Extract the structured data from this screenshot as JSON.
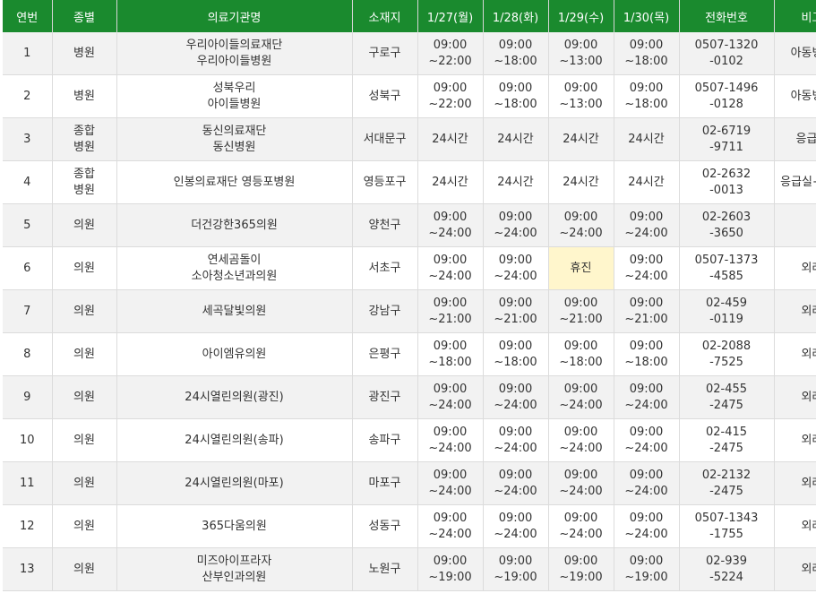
{
  "headers": [
    "연번",
    "종별",
    "의료기관명",
    "소재지",
    "1/27(월)",
    "1/28(화)",
    "1/29(수)",
    "1/30(목)",
    "전화번호",
    "비고"
  ],
  "closed_color": "#fff6cc",
  "header_color": "#1a8a2e",
  "rows": [
    {
      "no": "1",
      "type": [
        "병원"
      ],
      "name": [
        "우리아이들의료재단",
        "우리아이들병원"
      ],
      "loc": "구로구",
      "d1": [
        "09:00",
        "~22:00"
      ],
      "d2": [
        "09:00",
        "~18:00"
      ],
      "d3": [
        "09:00",
        "~13:00"
      ],
      "d4": [
        "09:00",
        "~18:00"
      ],
      "tel": [
        "0507-1320",
        "-0102"
      ],
      "note": "아동병원"
    },
    {
      "no": "2",
      "type": [
        "병원"
      ],
      "name": [
        "성북우리",
        "아이들병원"
      ],
      "loc": "성북구",
      "d1": [
        "09:00",
        "~22:00"
      ],
      "d2": [
        "09:00",
        "~18:00"
      ],
      "d3": [
        "09:00",
        "~13:00"
      ],
      "d4": [
        "09:00",
        "~18:00"
      ],
      "tel": [
        "0507-1496",
        "-0128"
      ],
      "note": "아동병원"
    },
    {
      "no": "3",
      "type": [
        "종합",
        "병원"
      ],
      "name": [
        "동신의료재단",
        "동신병원"
      ],
      "loc": "서대문구",
      "d1": [
        "24시간"
      ],
      "d2": [
        "24시간"
      ],
      "d3": [
        "24시간"
      ],
      "d4": [
        "24시간"
      ],
      "tel": [
        "02-6719",
        "-9711"
      ],
      "note": "응급실"
    },
    {
      "no": "4",
      "type": [
        "종합",
        "병원"
      ],
      "name": [
        "인봉의료재단 영등포병원"
      ],
      "loc": "영등포구",
      "d1": [
        "24시간"
      ],
      "d2": [
        "24시간"
      ],
      "d3": [
        "24시간"
      ],
      "d4": [
        "24시간"
      ],
      "tel": [
        "02-2632",
        "-0013"
      ],
      "note": "응급실+외래"
    },
    {
      "no": "5",
      "type": [
        "의원"
      ],
      "name": [
        "더건강한365의원"
      ],
      "loc": "양천구",
      "d1": [
        "09:00",
        "~24:00"
      ],
      "d2": [
        "09:00",
        "~24:00"
      ],
      "d3": [
        "09:00",
        "~24:00"
      ],
      "d4": [
        "09:00",
        "~24:00"
      ],
      "tel": [
        "02-2603",
        "-3650"
      ],
      "note": ""
    },
    {
      "no": "6",
      "type": [
        "의원"
      ],
      "name": [
        "연세곰돌이",
        "소아청소년과의원"
      ],
      "loc": "서초구",
      "d1": [
        "09:00",
        "~24:00"
      ],
      "d2": [
        "09:00",
        "~24:00"
      ],
      "d3": [
        "휴진"
      ],
      "d4": [
        "09:00",
        "~24:00"
      ],
      "tel": [
        "0507-1373",
        "-4585"
      ],
      "note": "외래",
      "closed_day": "d3"
    },
    {
      "no": "7",
      "type": [
        "의원"
      ],
      "name": [
        "세곡달빛의원"
      ],
      "loc": "강남구",
      "d1": [
        "09:00",
        "~21:00"
      ],
      "d2": [
        "09:00",
        "~21:00"
      ],
      "d3": [
        "09:00",
        "~21:00"
      ],
      "d4": [
        "09:00",
        "~21:00"
      ],
      "tel": [
        "02-459",
        "-0119"
      ],
      "note": "외래"
    },
    {
      "no": "8",
      "type": [
        "의원"
      ],
      "name": [
        "아이엠유의원"
      ],
      "loc": "은평구",
      "d1": [
        "09:00",
        "~18:00"
      ],
      "d2": [
        "09:00",
        "~18:00"
      ],
      "d3": [
        "09:00",
        "~18:00"
      ],
      "d4": [
        "09:00",
        "~18:00"
      ],
      "tel": [
        "02-2088",
        "-7525"
      ],
      "note": "외래"
    },
    {
      "no": "9",
      "type": [
        "의원"
      ],
      "name": [
        "24시열린의원(광진)"
      ],
      "loc": "광진구",
      "d1": [
        "09:00",
        "~24:00"
      ],
      "d2": [
        "09:00",
        "~24:00"
      ],
      "d3": [
        "09:00",
        "~24:00"
      ],
      "d4": [
        "09:00",
        "~24:00"
      ],
      "tel": [
        "02-455",
        "-2475"
      ],
      "note": "외래"
    },
    {
      "no": "10",
      "type": [
        "의원"
      ],
      "name": [
        "24시열린의원(송파)"
      ],
      "loc": "송파구",
      "d1": [
        "09:00",
        "~24:00"
      ],
      "d2": [
        "09:00",
        "~24:00"
      ],
      "d3": [
        "09:00",
        "~24:00"
      ],
      "d4": [
        "09:00",
        "~24:00"
      ],
      "tel": [
        "02-415",
        "-2475"
      ],
      "note": "외래"
    },
    {
      "no": "11",
      "type": [
        "의원"
      ],
      "name": [
        "24시열린의원(마포)"
      ],
      "loc": "마포구",
      "d1": [
        "09:00",
        "~24:00"
      ],
      "d2": [
        "09:00",
        "~24:00"
      ],
      "d3": [
        "09:00",
        "~24:00"
      ],
      "d4": [
        "09:00",
        "~24:00"
      ],
      "tel": [
        "02-2132",
        "-2475"
      ],
      "note": "외래"
    },
    {
      "no": "12",
      "type": [
        "의원"
      ],
      "name": [
        "365다움의원"
      ],
      "loc": "성동구",
      "d1": [
        "09:00",
        "~24:00"
      ],
      "d2": [
        "09:00",
        "~24:00"
      ],
      "d3": [
        "09:00",
        "~24:00"
      ],
      "d4": [
        "09:00",
        "~24:00"
      ],
      "tel": [
        "0507-1343",
        "-1755"
      ],
      "note": "외래"
    },
    {
      "no": "13",
      "type": [
        "의원"
      ],
      "name": [
        "미즈아이프라자",
        "산부인과의원"
      ],
      "loc": "노원구",
      "d1": [
        "09:00",
        "~19:00"
      ],
      "d2": [
        "09:00",
        "~19:00"
      ],
      "d3": [
        "09:00",
        "~19:00"
      ],
      "d4": [
        "09:00",
        "~19:00"
      ],
      "tel": [
        "02-939",
        "-5224"
      ],
      "note": "외래"
    }
  ]
}
